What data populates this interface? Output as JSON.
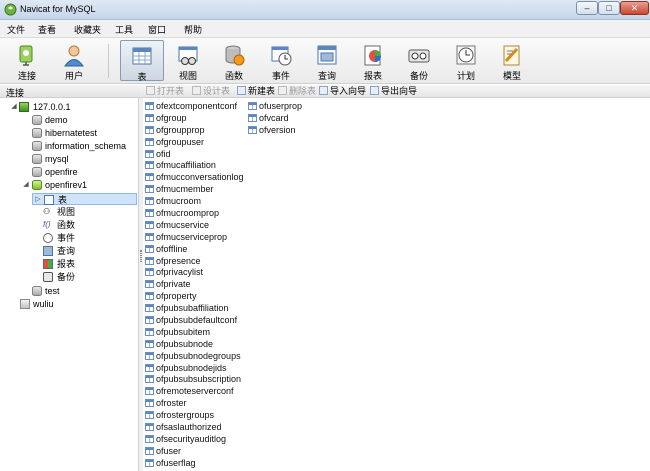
{
  "window": {
    "title": "Navicat for MySQL",
    "min": "–",
    "max": "□",
    "close": "✕"
  },
  "menu": [
    "文件",
    "查看",
    "收藏夹",
    "工具",
    "窗口",
    "帮助"
  ],
  "toolbar": {
    "connect": "连接",
    "user": "用户",
    "table": "表",
    "view": "视图",
    "function": "函数",
    "event": "事件",
    "query": "查询",
    "report": "报表",
    "backup": "备份",
    "schedule": "计划",
    "model": "模型"
  },
  "conn_header": "连接",
  "obj_toolbar": {
    "open": "打开表",
    "design": "设计表",
    "new": "新建表",
    "delete": "删除表",
    "import": "导入向导",
    "export": "导出向导"
  },
  "tree": {
    "server": "127.0.0.1",
    "databases": [
      "demo",
      "hibernatetest",
      "information_schema",
      "mysql",
      "openfire",
      "openfirev1"
    ],
    "children": [
      "表",
      "视图",
      "函数",
      "事件",
      "查询",
      "报表",
      "备份"
    ],
    "after": [
      "test"
    ],
    "server2": "wuliu"
  },
  "tables_col1": [
    "ofextcomponentconf",
    "ofgroup",
    "ofgroupprop",
    "ofgroupuser",
    "ofid",
    "ofmucaffiliation",
    "ofmucconversationlog",
    "ofmucmember",
    "ofmucroom",
    "ofmucroomprop",
    "ofmucservice",
    "ofmucserviceprop",
    "ofoffline",
    "ofpresence",
    "ofprivacylist",
    "ofprivate",
    "ofproperty",
    "ofpubsubaffiliation",
    "ofpubsubdefaultconf",
    "ofpubsubitem",
    "ofpubsubnode",
    "ofpubsubnodegroups",
    "ofpubsubnodejids",
    "ofpubsubsubscription",
    "ofremoteserverconf",
    "ofroster",
    "ofrostergroups",
    "ofsaslauthorized",
    "ofsecurityauditlog",
    "ofuser",
    "ofuserflag"
  ],
  "tables_col2": [
    "ofuserprop",
    "ofvcard",
    "ofversion"
  ]
}
